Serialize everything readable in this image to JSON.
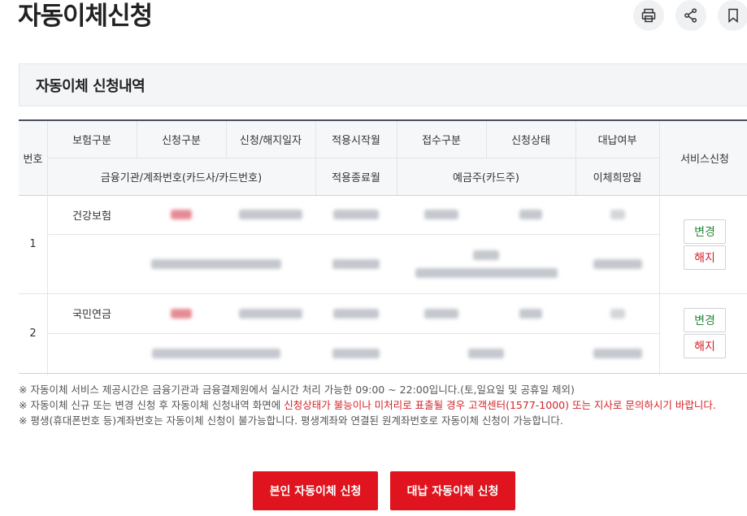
{
  "page": {
    "title": "자동이체신청",
    "actions": [
      {
        "icon": "print-icon"
      },
      {
        "icon": "share-icon"
      },
      {
        "icon": "bookmark-icon"
      }
    ]
  },
  "section": {
    "title": "자동이체 신청내역"
  },
  "table": {
    "headers": {
      "no": "번호",
      "insurance_type": "보험구분",
      "request_type": "신청구분",
      "request_date": "신청/해지일자",
      "start_month": "적용시작월",
      "receipt_type": "접수구분",
      "request_status": "신청상태",
      "proxy_payment": "대납여부",
      "service": "서비스신청",
      "bank_account": "금융기관/계좌번호(카드사/카드번호)",
      "end_month": "적용종료월",
      "depositor": "예금주(카드주)",
      "transfer_day": "이체희망일"
    },
    "rows": [
      {
        "no": "1",
        "insurance_type": "건강보험",
        "change_label": "변경",
        "cancel_label": "해지"
      },
      {
        "no": "2",
        "insurance_type": "국민연금",
        "change_label": "변경",
        "cancel_label": "해지"
      }
    ]
  },
  "notes": {
    "line1": "※ 자동이체 서비스 제공시간은 금융기관과 금융결제원에서 실시간 처리 가능한 09:00 ~ 22:00입니다.(토,일요일 및 공휴일 제외)",
    "line2_prefix": "※ 자동이체 신규 또는 변경 신청 후 자동이체 신청내역 화면에 ",
    "line2_highlight": "신청상태가 불능이나 미처리로 표출될 경우 고객센터(1577-1000) 또는 지사로 문의하시기 바랍니다.",
    "line3": "※ 평생(휴대폰번호 등)계좌번호는 자동이체 신청이 불가능합니다. 평생계좌와 연결된 원계좌번호로 자동이체 신청이 가능합니다."
  },
  "buttons": {
    "self_apply": "본인 자동이체 신청",
    "proxy_apply": "대납 자동이체 신청"
  },
  "colors": {
    "accent_red": "#e0141e",
    "change_green": "#2a8a3c",
    "cancel_red": "#d3232a"
  }
}
